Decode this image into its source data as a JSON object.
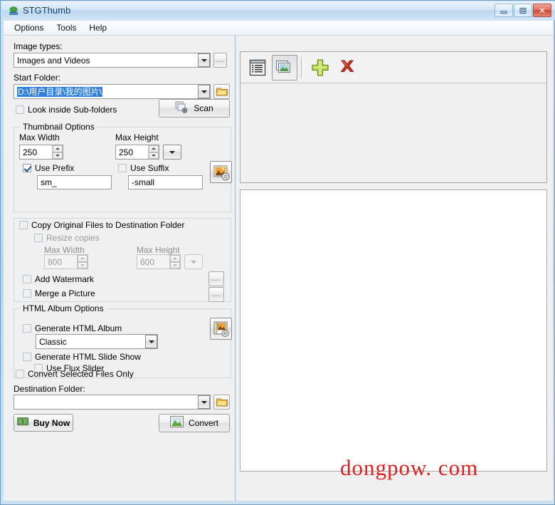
{
  "window": {
    "title": "STGThumb",
    "app_icon": "stgthumb-icon",
    "buttons": {
      "minimize": "–",
      "maximize": "□",
      "close": "✕"
    }
  },
  "menubar": {
    "items": [
      {
        "label": "Options"
      },
      {
        "label": "Tools"
      },
      {
        "label": "Help"
      }
    ]
  },
  "left_panel": {
    "image_types": {
      "label": "Image types:",
      "value": "Images and Videos",
      "browse_label": "..."
    },
    "start_folder": {
      "label": "Start Folder:",
      "value": "D:\\用户目录\\我的图片\\",
      "selected": true
    },
    "look_inside_subfolders": {
      "label": "Look inside Sub-folders",
      "checked": false
    },
    "scan_button": {
      "label": "Scan"
    },
    "thumbnail_options": {
      "title": "Thumbnail Options",
      "max_width_label": "Max Width",
      "max_width_value": "250",
      "max_height_label": "Max Height",
      "max_height_value": "250",
      "use_prefix": {
        "label": "Use Prefix",
        "checked": true,
        "value": "sm_"
      },
      "use_suffix": {
        "label": "Use Suffix",
        "checked": false,
        "value": "-small"
      }
    },
    "copy_original": {
      "label": "Copy Original Files to Destination Folder",
      "checked": false
    },
    "resize_copies": {
      "label": "Resize copies",
      "checked": false,
      "disabled": true
    },
    "copy_max_width_label": "Max Width",
    "copy_max_width_value": "800",
    "copy_max_height_label": "Max Height",
    "copy_max_height_value": "600",
    "add_watermark": {
      "label": "Add Watermark",
      "checked": false,
      "browse_label": "..."
    },
    "merge_picture": {
      "label": "Merge a Picture",
      "checked": false,
      "browse_label": "..."
    },
    "html_album_options": {
      "title": "HTML Album Options",
      "generate_html_album": {
        "label": "Generate HTML Album",
        "checked": false
      },
      "template_value": "Classic",
      "generate_slide_show": {
        "label": "Generate HTML Slide Show",
        "checked": false
      },
      "use_flux_slider": {
        "label": "Use Flux Slider",
        "checked": false
      }
    },
    "convert_selected_only": {
      "label": "Convert Selected Files Only",
      "checked": false
    },
    "destination_folder": {
      "label": "Destination Folder:",
      "value": ""
    },
    "buy_now_button": {
      "label": "Buy Now"
    },
    "convert_button": {
      "label": "Convert"
    }
  },
  "right_panel": {
    "toolbar": [
      {
        "name": "list-view-button",
        "icon": "list-view-icon",
        "pressed": false
      },
      {
        "name": "thumbnail-view-button",
        "icon": "thumbnail-view-icon",
        "pressed": true
      },
      {
        "name": "add-files-button",
        "icon": "plus-icon",
        "pressed": false
      },
      {
        "name": "remove-files-button",
        "icon": "red-x-icon",
        "pressed": false
      }
    ],
    "file_list_empty": "",
    "preview_empty": ""
  },
  "watermark": {
    "text": "dongpow. com",
    "color": "#e02020"
  },
  "colors": {
    "accent_blue": "#2a7fe0",
    "window_frame": "#6f9ec4",
    "panel_bg": "#f0f0f0",
    "close_button": "#cc4a37",
    "watermark_red": "#e02020"
  }
}
